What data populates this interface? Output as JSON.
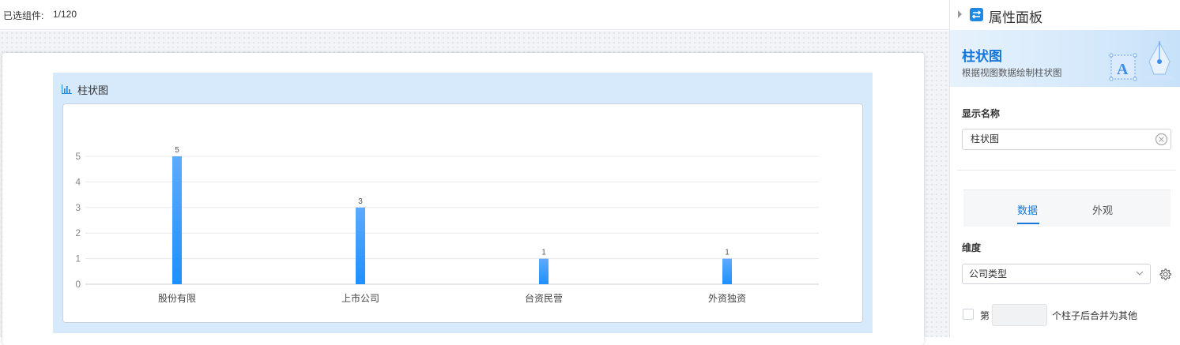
{
  "topbar": {
    "selected_label": "已选组件:",
    "selected_count": "1/120"
  },
  "widget": {
    "title": "柱状图",
    "icon": "bar-chart-icon"
  },
  "chart_data": {
    "type": "bar",
    "categories": [
      "股份有限",
      "上市公司",
      "台资民营",
      "外资独资"
    ],
    "values": [
      5,
      3,
      1,
      1
    ],
    "data_labels": [
      "5",
      "3",
      "1",
      "1"
    ],
    "yticks": [
      "0",
      "1",
      "2",
      "3",
      "4",
      "5"
    ],
    "ylim": [
      0,
      5
    ],
    "grid": true,
    "bar_color": "#1e90ff"
  },
  "panel": {
    "title": "属性面板",
    "icon": "panel-settings-icon",
    "banner_title": "柱状图",
    "banner_desc": "根据视图数据绘制柱状图",
    "name_label": "显示名称",
    "name_value": "柱状图",
    "tabs": [
      "数据",
      "外观"
    ],
    "active_tab": "数据",
    "dimension_label": "维度",
    "dimension_value": "公司类型",
    "merge_prefix": "第",
    "merge_suffix": "个柱子后合并为其他",
    "merge_value": "",
    "accent_color": "#1677d9"
  }
}
